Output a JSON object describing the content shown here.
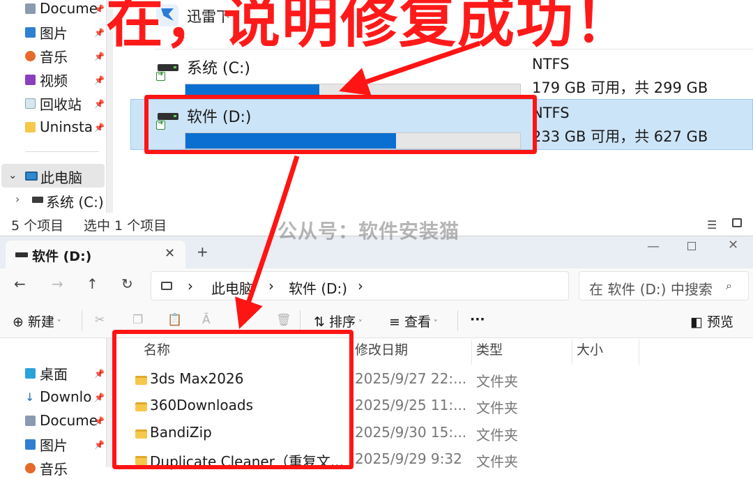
{
  "headline": "在，说明修复成功！",
  "watermark": "公从号：软件安装猫",
  "top_window": {
    "nav_items": [
      {
        "label": "Docume",
        "icon": "document-icon"
      },
      {
        "label": "图片",
        "icon": "pictures-icon"
      },
      {
        "label": "音乐",
        "icon": "music-icon"
      },
      {
        "label": "视频",
        "icon": "video-icon"
      },
      {
        "label": "回收站",
        "icon": "recycle-bin-icon"
      },
      {
        "label": "Uninsta",
        "icon": "folder-icon"
      }
    ],
    "this_pc": "此电脑",
    "sys_c": "系统 (C:)",
    "thunder": "迅雷下",
    "drives": [
      {
        "label": "系统 (C:)",
        "fs": "NTFS",
        "free": "179 GB 可用，共 299 GB",
        "used_fraction": 0.4
      },
      {
        "label": "软件 (D:)",
        "fs": "NTFS",
        "free": "233 GB 可用，共 627 GB",
        "used_fraction": 0.63
      }
    ],
    "status": {
      "count": "5 个项目",
      "selected": "选中 1 个项目"
    }
  },
  "bottom_window": {
    "tab": {
      "label": "软件 (D:)",
      "close": "✕",
      "new": "+"
    },
    "window_controls": {
      "min": "—",
      "close": "✕"
    },
    "nav": {
      "back": "←",
      "forward": "→",
      "up": "↑",
      "refresh": "↻"
    },
    "breadcrumb": [
      "此电脑",
      "软件 (D:)"
    ],
    "breadcrumb_sep": "›",
    "search_placeholder": "在 软件 (D:) 中搜索",
    "toolbar": {
      "new": "新建",
      "sort": "排序",
      "view": "查看",
      "more": "···",
      "preview": "预览"
    },
    "nav_items": [
      {
        "label": "桌面"
      },
      {
        "label": "Downlo"
      },
      {
        "label": "Docume"
      },
      {
        "label": "图片"
      },
      {
        "label": "音乐"
      }
    ],
    "columns": {
      "name": "名称",
      "modified": "修改日期",
      "type": "类型",
      "size": "大小"
    },
    "files": [
      {
        "name": "3ds Max2026",
        "modified": "2025/9/27 22:...",
        "type": "文件夹"
      },
      {
        "name": "360Downloads",
        "modified": "2025/9/25 11:...",
        "type": "文件夹"
      },
      {
        "name": "BandiZip",
        "modified": "2025/9/30 15:...",
        "type": "文件夹"
      },
      {
        "name": "Duplicate Cleaner（重复文...",
        "modified": "2025/9/29 9:32",
        "type": "文件夹"
      }
    ]
  },
  "colors": {
    "accent": "#0a6fd0",
    "highlight": "#ff1414",
    "selection": "#cce4f7"
  }
}
